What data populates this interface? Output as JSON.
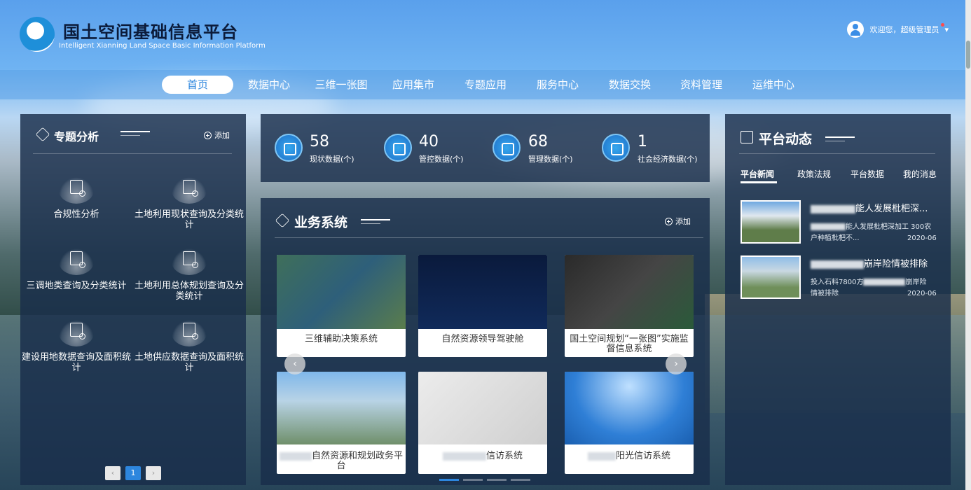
{
  "header": {
    "title": "国土空间基础信息平台",
    "subtitle": "Intelligent Xianning Land Space Basic Information Platform",
    "welcome": "欢迎您，超级管理员",
    "dropdown_arrow": "▾"
  },
  "nav": {
    "items": [
      "首页",
      "数据中心",
      "三维一张图",
      "应用集市",
      "专题应用",
      "服务中心",
      "数据交换",
      "资料管理",
      "运维中心"
    ],
    "active_index": 0
  },
  "thematic": {
    "title": "专题分析",
    "add_label": "添加",
    "items": [
      "合规性分析",
      "土地利用现状查询及分类统计",
      "三调地类查询及分类统计",
      "土地利用总体规划查询及分类统计",
      "建设用地数据查询及面积统计",
      "土地供应数据查询及面积统计"
    ],
    "pager": {
      "prev": "‹",
      "page": "1",
      "next": "›"
    }
  },
  "stats": [
    {
      "value": "58",
      "label": "现状数据(个)",
      "icon": "snowflake-icon"
    },
    {
      "value": "40",
      "label": "管控数据(个)",
      "icon": "hand-icon"
    },
    {
      "value": "68",
      "label": "管理数据(个)",
      "icon": "cloud-icon"
    },
    {
      "value": "1",
      "label": "社会经济数据(个)",
      "icon": "monitor-icon"
    }
  ],
  "business": {
    "title": "业务系统",
    "add_label": "添加",
    "prev": "‹",
    "next": "›",
    "cards": [
      "三维辅助决策系统",
      "自然资源领导驾驶舱",
      "国土空间规划“一张图”实施监督信息系统",
      "自然资源和规划政务平台",
      "信访系统",
      "阳光信访系统"
    ]
  },
  "news": {
    "title": "平台动态",
    "tabs": [
      "平台新闻",
      "政策法规",
      "平台数据",
      "我的消息"
    ],
    "active_tab": 0,
    "items": [
      {
        "title": "能人发展枇杷深...",
        "summary1": "能人发展枇杷深加工 300农",
        "summary2": "户种植枇杷不...",
        "date": "2020-06"
      },
      {
        "title": "崩岸险情被排除",
        "summary1": "投入石料7800方",
        "summary1b": "崩岸险",
        "summary2": "情被排除",
        "date": "2020-06"
      }
    ]
  },
  "colors": {
    "accent": "#2d86de",
    "panel": "#192d4b"
  }
}
